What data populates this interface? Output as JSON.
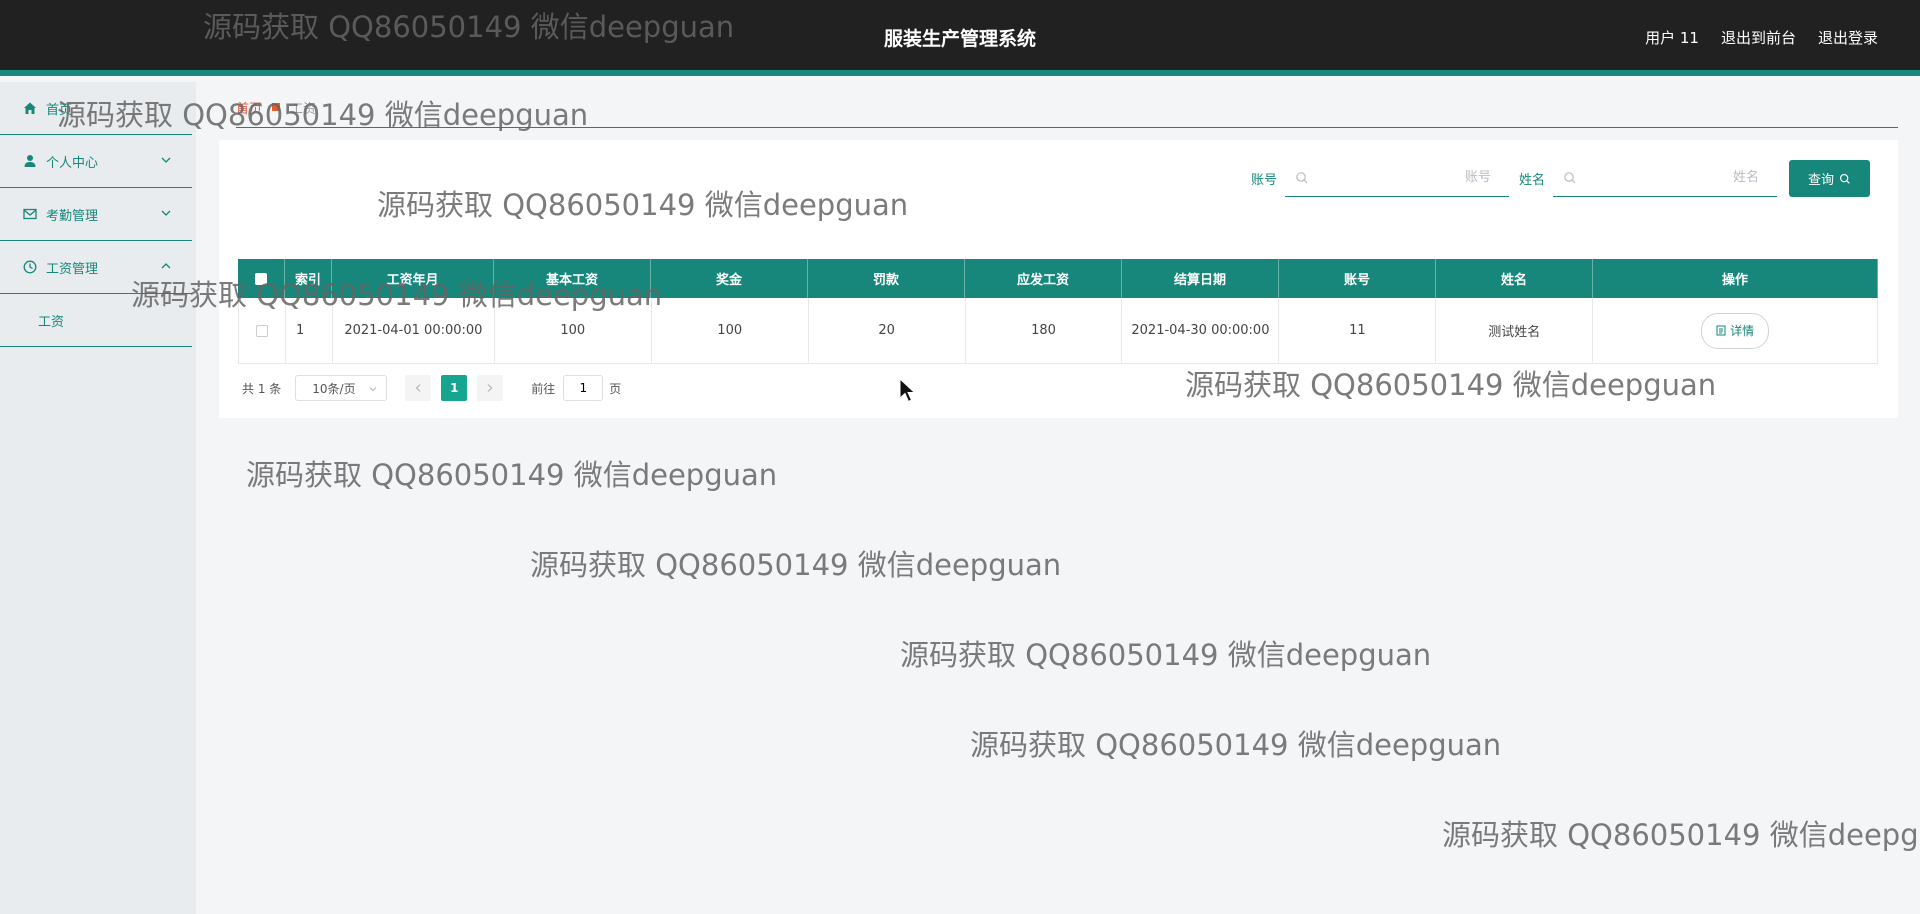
{
  "header": {
    "title": "服装生产管理系统",
    "user": "用户 11",
    "to_front": "退出到前台",
    "logout": "退出登录"
  },
  "sidebar": {
    "items": [
      {
        "label": "首页",
        "icon": "home-icon"
      },
      {
        "label": "个人中心",
        "icon": "user-icon"
      },
      {
        "label": "考勤管理",
        "icon": "mail-icon"
      },
      {
        "label": "工资管理",
        "icon": "clock-icon"
      }
    ],
    "submenu": [
      {
        "label": "工资"
      }
    ]
  },
  "breadcrumb": {
    "home": "首页",
    "current": "工资"
  },
  "search": {
    "account_label": "账号",
    "account_placeholder": "账号",
    "name_label": "姓名",
    "name_placeholder": "姓名",
    "query_label": "查询"
  },
  "table": {
    "headers": [
      "索引",
      "工资年月",
      "基本工资",
      "奖金",
      "罚款",
      "应发工资",
      "结算日期",
      "账号",
      "姓名",
      "操作"
    ],
    "rows": [
      {
        "index": "1",
        "month": "2021-04-01 00:00:00",
        "base": "100",
        "bonus": "100",
        "fine": "20",
        "payable": "180",
        "settle_date": "2021-04-30 00:00:00",
        "account": "11",
        "name": "测试姓名",
        "action": "详情"
      }
    ]
  },
  "pager": {
    "total": "共 1 条",
    "page_size": "10条/页",
    "current": "1",
    "goto_label": "前往",
    "goto_value": "1",
    "page_suffix": "页"
  },
  "watermark": "源码获取 QQ86050149 微信deepguan",
  "colors": {
    "accent": "#16877a",
    "header_bg": "#212121",
    "page_active": "#16a68f"
  }
}
